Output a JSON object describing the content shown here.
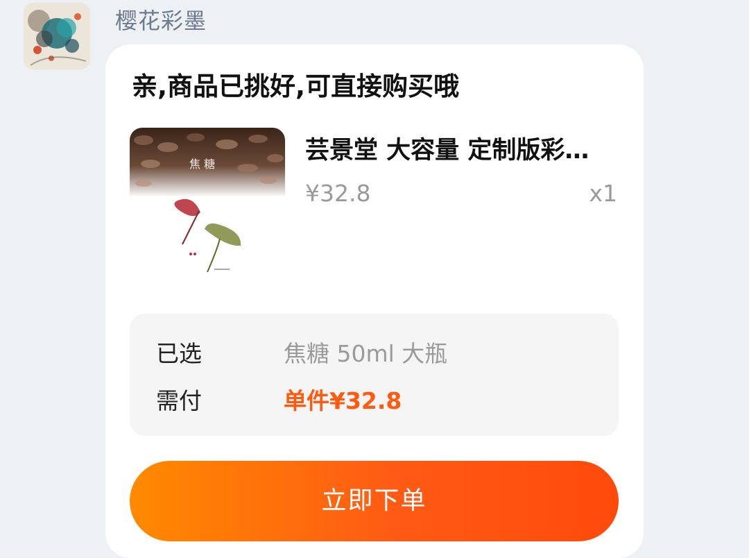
{
  "message": {
    "sender_name": "樱花彩墨"
  },
  "card": {
    "title": "亲,商品已挑好,可直接购买哦",
    "product": {
      "name": "芸景堂 大容量 定制版彩…",
      "price": "¥32.8",
      "quantity": "x1",
      "image_caption": "焦 糖"
    },
    "details": {
      "selected_label": "已选",
      "selected_value": "焦糖 50ml 大瓶",
      "pay_label": "需付",
      "pay_value": "单件¥32.8"
    },
    "order_button_label": "立即下单"
  },
  "colors": {
    "accent": "#ff5a0f",
    "button_gradient_start": "#ff8a00",
    "button_gradient_end": "#ff4a0c",
    "background": "#eef1f4",
    "card": "#ffffff"
  }
}
